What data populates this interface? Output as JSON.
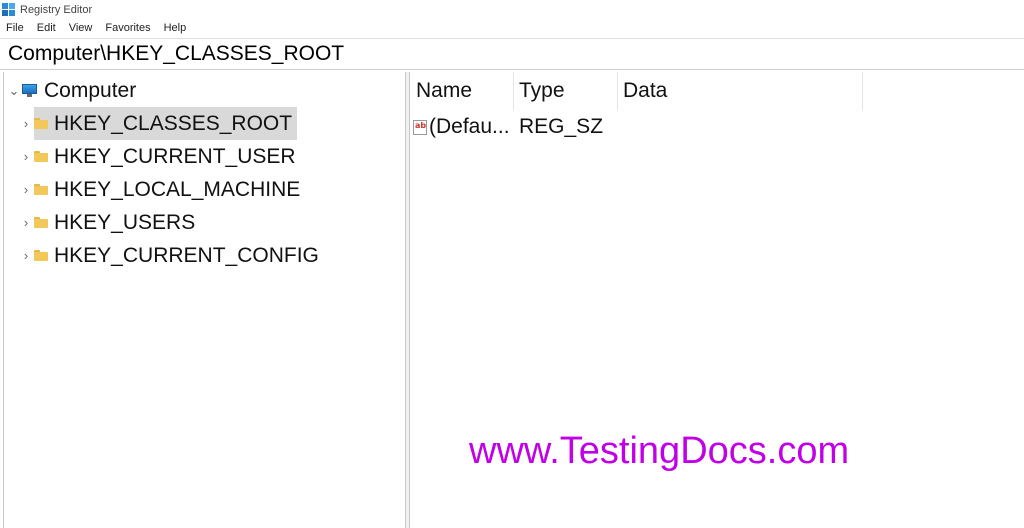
{
  "window": {
    "title": "Registry Editor",
    "app_icon": "registry-editor-icon"
  },
  "menu": {
    "items": [
      "File",
      "Edit",
      "View",
      "Favorites",
      "Help"
    ]
  },
  "address": {
    "path": "Computer\\HKEY_CLASSES_ROOT"
  },
  "tree": {
    "root": {
      "label": "Computer",
      "icon": "computer-icon",
      "expanded": true
    },
    "children": [
      {
        "label": "HKEY_CLASSES_ROOT",
        "icon": "folder-icon",
        "selected": true
      },
      {
        "label": "HKEY_CURRENT_USER",
        "icon": "folder-icon",
        "selected": false
      },
      {
        "label": "HKEY_LOCAL_MACHINE",
        "icon": "folder-icon",
        "selected": false
      },
      {
        "label": "HKEY_USERS",
        "icon": "folder-icon",
        "selected": false
      },
      {
        "label": "HKEY_CURRENT_CONFIG",
        "icon": "folder-icon",
        "selected": false
      }
    ]
  },
  "list": {
    "columns": [
      "Name",
      "Type",
      "Data"
    ],
    "rows": [
      {
        "icon": "string-value-icon",
        "name": "(Defau...",
        "type": "REG_SZ",
        "data": ""
      }
    ]
  },
  "watermark": {
    "text": "www.TestingDocs.com",
    "color": "#c200e8"
  },
  "colors": {
    "selection": "#d9d9d9",
    "folder": "#f2c85b"
  }
}
